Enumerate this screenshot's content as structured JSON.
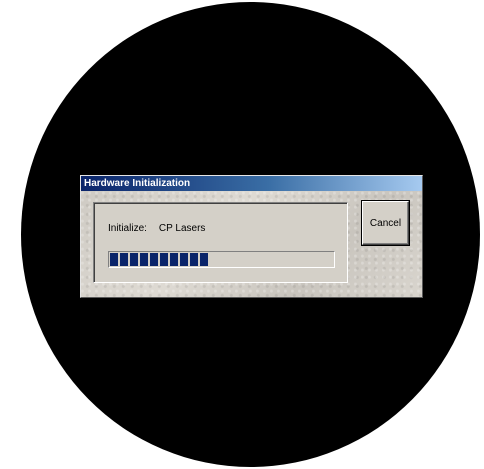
{
  "dialog": {
    "title": "Hardware Initialization",
    "status_label": "Initialize:",
    "status_value": "CP Lasers",
    "progress_fraction": 0.45,
    "cancel_label": "Cancel"
  },
  "colors": {
    "background": "#000000",
    "page": "#ffffff",
    "titlebar_start": "#0a246a",
    "titlebar_end": "#a6caf0",
    "progress_fill": "#0a246a",
    "dialog_face": "#d4d0c8"
  }
}
